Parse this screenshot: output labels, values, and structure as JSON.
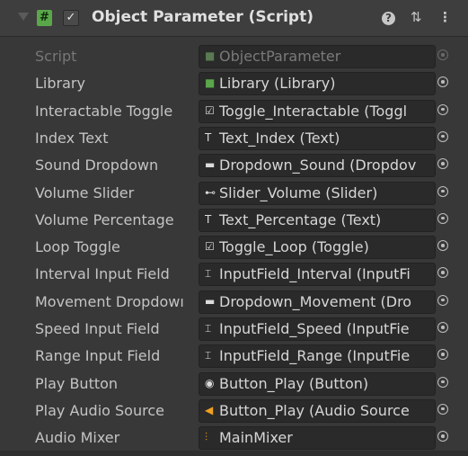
{
  "header": {
    "title": "Object Parameter (Script)",
    "script_icon_glyph": "#",
    "enabled_glyph": "✓",
    "help_glyph": "?",
    "preset_glyph": "⇅",
    "menu_glyph": "⋮"
  },
  "rows": [
    {
      "label": "Script",
      "value": "ObjectParameter",
      "icon": "script-icon",
      "glyph": "■",
      "disabled": true
    },
    {
      "label": "Library",
      "value": "Library (Library)",
      "icon": "script-icon",
      "glyph": "■"
    },
    {
      "label": "Interactable Toggle",
      "value": "Toggle_Interactable (Toggl",
      "icon": "toggle-icon",
      "glyph": "☑"
    },
    {
      "label": "Index Text",
      "value": "Text_Index (Text)",
      "icon": "text-icon",
      "glyph": "T"
    },
    {
      "label": "Sound Dropdown",
      "value": "Dropdown_Sound (Dropdoᴠ",
      "icon": "dropdown-icon",
      "glyph": "▬"
    },
    {
      "label": "Volume Slider",
      "value": "Slider_Volume (Slider)",
      "icon": "slider-icon",
      "glyph": "⊷"
    },
    {
      "label": "Volume Percentage",
      "value": "Text_Percentage (Text)",
      "icon": "text-icon",
      "glyph": "T"
    },
    {
      "label": "Loop Toggle",
      "value": "Toggle_Loop (Toggle)",
      "icon": "toggle-icon",
      "glyph": "☑"
    },
    {
      "label": "Interval Input Field",
      "value": "InputField_Interval (InputFi",
      "icon": "inputfield-icon",
      "glyph": "⌶"
    },
    {
      "label": "Movement Dropdowı",
      "value": "Dropdown_Movement (Dro",
      "icon": "dropdown-icon",
      "glyph": "▬"
    },
    {
      "label": "Speed Input Field",
      "value": "InputField_Speed (InputFie",
      "icon": "inputfield-icon",
      "glyph": "⌶"
    },
    {
      "label": "Range Input Field",
      "value": "InputField_Range (InputFie",
      "icon": "inputfield-icon",
      "glyph": "⌶"
    },
    {
      "label": "Play Button",
      "value": "Button_Play (Button)",
      "icon": "button-icon",
      "glyph": "◉"
    },
    {
      "label": "Play Audio Source",
      "value": "Button_Play (Audio Source",
      "icon": "audio-source-icon",
      "glyph": "◀"
    },
    {
      "label": "Audio Mixer",
      "value": "MainMixer",
      "icon": "audio-mixer-icon",
      "glyph": "⫶"
    }
  ],
  "colors": {
    "background": "#383838",
    "field": "#2a2a2a",
    "script_green": "#5aa74a",
    "audio_orange": "#f0a020"
  }
}
